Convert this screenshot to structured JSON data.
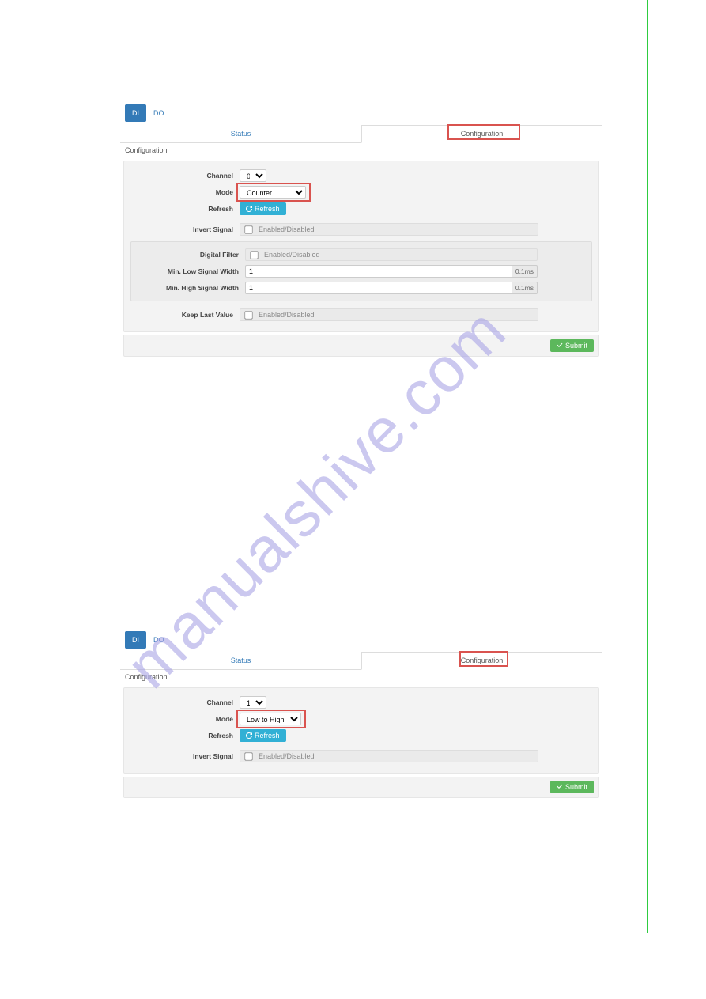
{
  "watermark": "manualshive.com",
  "panels": [
    {
      "io_tabs": {
        "di": "DI",
        "do": "DO",
        "active": "di"
      },
      "sc_tabs": {
        "status": "Status",
        "configuration": "Configuration",
        "active": "configuration"
      },
      "header": "Configuration",
      "fields": {
        "channel_label": "Channel",
        "channel_value": "0",
        "mode_label": "Mode",
        "mode_value": "Counter",
        "refresh_label": "Refresh",
        "refresh_btn": "Refresh",
        "invert_label": "Invert Signal",
        "invert_placeholder": "Enabled/Disabled",
        "filter_label": "Digital Filter",
        "filter_placeholder": "Enabled/Disabled",
        "minlow_label": "Min. Low Signal Width",
        "minlow_value": "1",
        "minlow_suffix": "0.1ms",
        "minhigh_label": "Min. High Signal Width",
        "minhigh_value": "1",
        "minhigh_suffix": "0.1ms",
        "keeplast_label": "Keep Last Value",
        "keeplast_placeholder": "Enabled/Disabled"
      },
      "submit": "Submit"
    },
    {
      "io_tabs": {
        "di": "DI",
        "do": "DO",
        "active": "di"
      },
      "sc_tabs": {
        "status": "Status",
        "configuration": "Configuration",
        "active": "configuration"
      },
      "header": "Configuration",
      "fields": {
        "channel_label": "Channel",
        "channel_value": "1",
        "mode_label": "Mode",
        "mode_value": "Low to High Latch",
        "refresh_label": "Refresh",
        "refresh_btn": "Refresh",
        "invert_label": "Invert Signal",
        "invert_placeholder": "Enabled/Disabled"
      },
      "submit": "Submit"
    }
  ]
}
